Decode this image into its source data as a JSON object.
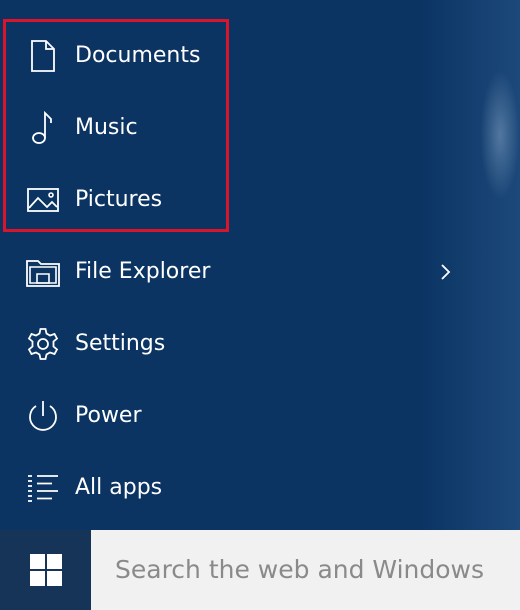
{
  "menu": {
    "items": [
      {
        "label": "Documents",
        "icon": "document-icon"
      },
      {
        "label": "Music",
        "icon": "music-note-icon"
      },
      {
        "label": "Pictures",
        "icon": "picture-icon"
      },
      {
        "label": "File Explorer",
        "icon": "file-explorer-icon",
        "has_submenu": true
      },
      {
        "label": "Settings",
        "icon": "gear-icon"
      },
      {
        "label": "Power",
        "icon": "power-icon"
      },
      {
        "label": "All apps",
        "icon": "list-icon"
      }
    ]
  },
  "search": {
    "placeholder": "Search the web and Windows"
  },
  "start_button": {
    "icon": "windows-logo-icon"
  },
  "colors": {
    "background": "#0b3463",
    "highlight_border": "#d9142b",
    "search_bg": "#f1f1f1",
    "search_text": "#8a8a8a"
  }
}
